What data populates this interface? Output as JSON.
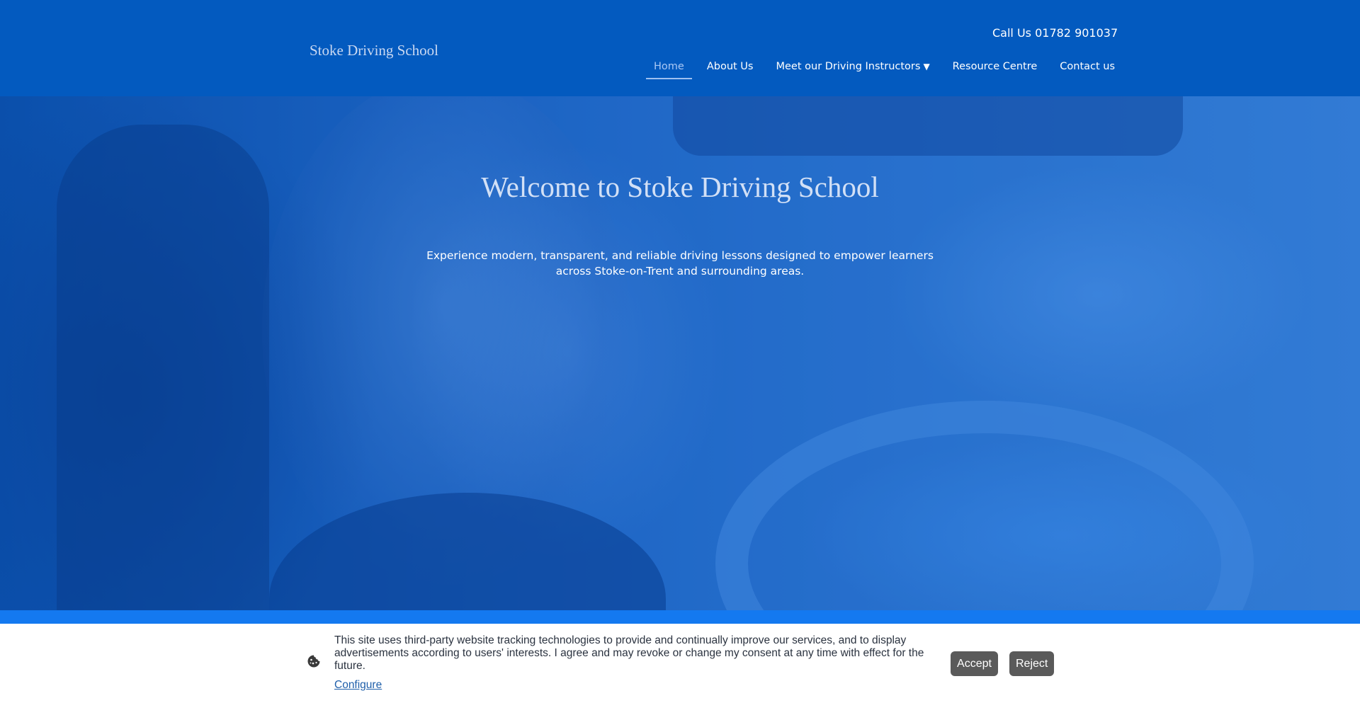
{
  "header": {
    "logo_text": "Stoke Driving School",
    "phone_text": "Call Us 01782  901037",
    "nav": [
      {
        "label": "Home",
        "active": true
      },
      {
        "label": "About Us",
        "active": false
      },
      {
        "label": "Meet our Driving Instructors",
        "active": false,
        "has_dropdown": true,
        "icon": "caret-down-icon"
      },
      {
        "label": "Resource Centre",
        "active": false
      },
      {
        "label": "Contact us",
        "active": false
      }
    ]
  },
  "hero": {
    "title": "Welcome to Stoke Driving School",
    "text": "Experience modern, transparent, and reliable driving lessons designed to empower learners across Stoke-on-Trent and surrounding areas."
  },
  "cookie_banner": {
    "icon": "cookie-icon",
    "text": "This site uses third-party website tracking technologies to provide and continually improve our services, and to display advertisements according to users' interests. I agree and may revoke or change my consent at any time with effect for the future.",
    "configure_label": "Configure",
    "accept_label": "Accept",
    "reject_label": "Reject"
  },
  "colors": {
    "header_bg": "#035abf",
    "accent_strip": "#1479f0",
    "button_bg": "#5a5a5a"
  }
}
